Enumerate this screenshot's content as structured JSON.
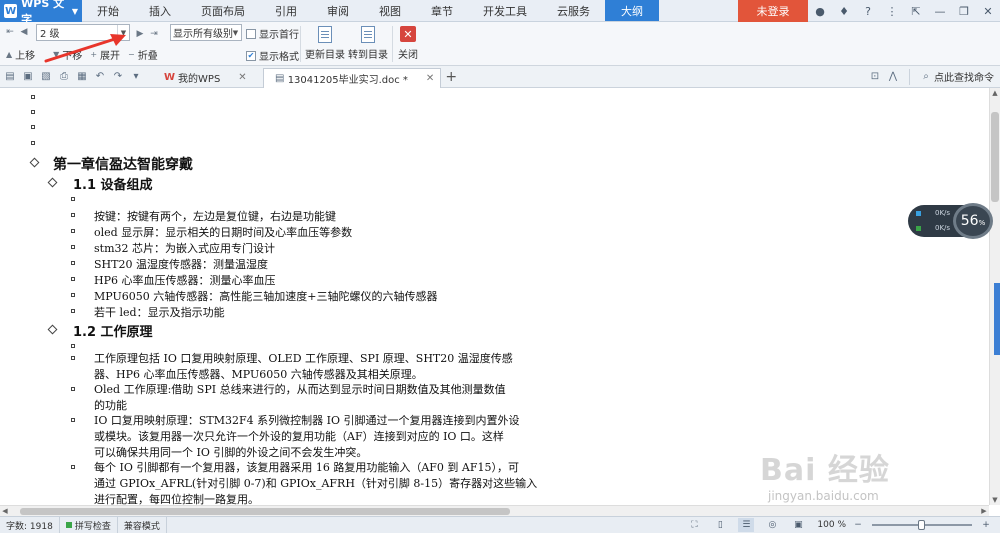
{
  "app": {
    "name": "WPS 文字"
  },
  "menu_tabs": [
    "开始",
    "插入",
    "页面布局",
    "引用",
    "审阅",
    "视图",
    "章节",
    "开发工具",
    "云服务",
    "大纲"
  ],
  "active_tab": "大纲",
  "login_label": "未登录",
  "ribbon": {
    "level_value": "2 级",
    "show_levels_value": "显示所有级别",
    "show_first_line_label": "显示首行",
    "show_format_label": "显示格式",
    "show_first_line_checked": false,
    "show_format_checked": true,
    "move_up_label": "上移",
    "move_down_label": "下移",
    "expand_label": "展开",
    "collapse_label": "折叠",
    "update_toc_label": "更新目录",
    "goto_toc_label": "转到目录",
    "close_label": "关闭"
  },
  "tabs": {
    "wps_home": "我的WPS",
    "document": "13041205毕业实习.doc *",
    "find_command": "点此查找命令"
  },
  "document": {
    "chapter1": "第一章信盈达智能穿戴",
    "section1_1": "1.1 设备组成",
    "items_1_1": [
      "按键：按键有两个，左边是复位键，右边是功能键",
      "oled 显示屏：显示相关的日期时间及心率血压等参数",
      "stm32 芯片：为嵌入式应用专门设计",
      "SHT20 温湿度传感器：测量温湿度",
      "HP6 心率血压传感器：测量心率血压",
      "MPU6050 六轴传感器：高性能三轴加速度+三轴陀螺仪的六轴传感器",
      "若干 led：显示及指示功能"
    ],
    "section1_2": "1.2 工作原理",
    "para1": [
      "工作原理包括 IO 口复用映射原理、OLED 工作原理、SPI 原理、SHT20 温湿度传感",
      "器、HP6 心率血压传感器、MPU6050 六轴传感器及其相关原理。"
    ],
    "para2": [
      "Oled 工作原理:借助 SPI 总线来进行的，从而达到显示时间日期数值及其他测量数值",
      "的功能"
    ],
    "para3": [
      "IO 口复用映射原理：STM32F4 系列微控制器 IO 引脚通过一个复用器连接到内置外设",
      "或模块。该复用器一次只允许一个外设的复用功能（AF）连接到对应的 IO 口。这样",
      "可以确保共用同一个 IO 引脚的外设之间不会发生冲突。"
    ],
    "para4": [
      "每个 IO 引脚都有一个复用器，该复用器采用 16 路复用功能输入（AF0 到 AF15），可",
      "通过 GPIOx_AFRL(针对引脚 0-7)和 GPIOx_AFRH（针对引脚 8-15）寄存器对这些输入",
      "进行配置，每四位控制一路复用。"
    ]
  },
  "speed_widget": {
    "up": "0K/s",
    "down": "0K/s",
    "percent": "56",
    "unit": "%"
  },
  "status": {
    "word_count": "字数: 1918",
    "spell_check": "拼写检查",
    "compat_mode": "兼容模式",
    "zoom": "100 %"
  },
  "watermark": {
    "brand": "Bai  经验",
    "url": "jingyan.baidu.com"
  },
  "colors": {
    "accent": "#2f7fd6",
    "login": "#e2553a",
    "annotation": "#e8352b"
  }
}
